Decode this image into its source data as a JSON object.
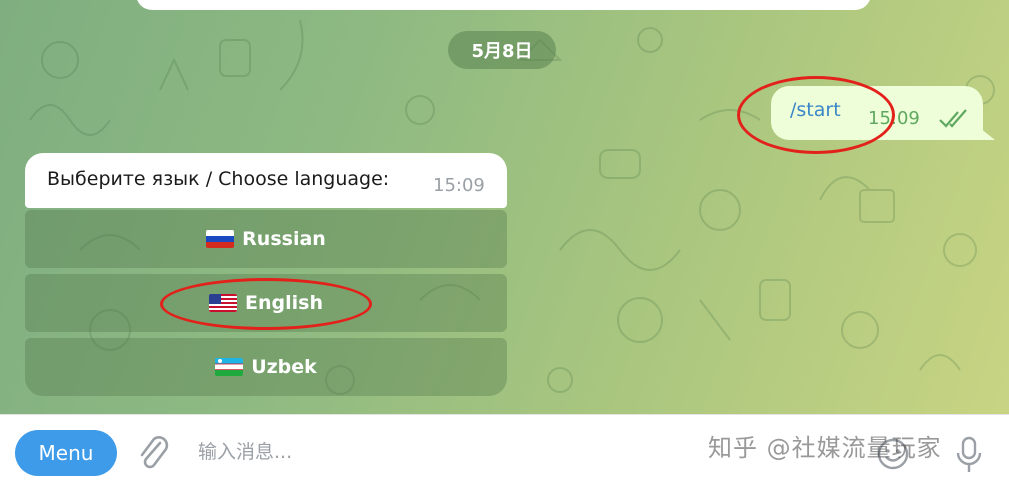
{
  "chat": {
    "date_separator": "5月8日",
    "outgoing": {
      "text": "/start",
      "time": "15:09",
      "status_icon": "double-check-icon"
    },
    "incoming": {
      "text": "Выберите язык / Choose language:",
      "time": "15:09"
    },
    "keyboard": [
      {
        "label": "Russian",
        "flag_icon": "flag-russia-icon"
      },
      {
        "label": "English",
        "flag_icon": "flag-usa-icon"
      },
      {
        "label": "Uzbek",
        "flag_icon": "flag-uzbekistan-icon"
      }
    ]
  },
  "composer": {
    "menu_label": "Menu",
    "placeholder": "输入消息...",
    "attach_icon": "paperclip-icon",
    "emoji_icon": "emoji-icon",
    "mic_icon": "microphone-icon"
  },
  "watermark": "知乎 @社媒流量玩家",
  "colors": {
    "menu_button": "#3d9be9",
    "outgoing_bubble": "#eefed8",
    "link_text": "#3a86c8",
    "highlight_ring": "#e3211b"
  }
}
